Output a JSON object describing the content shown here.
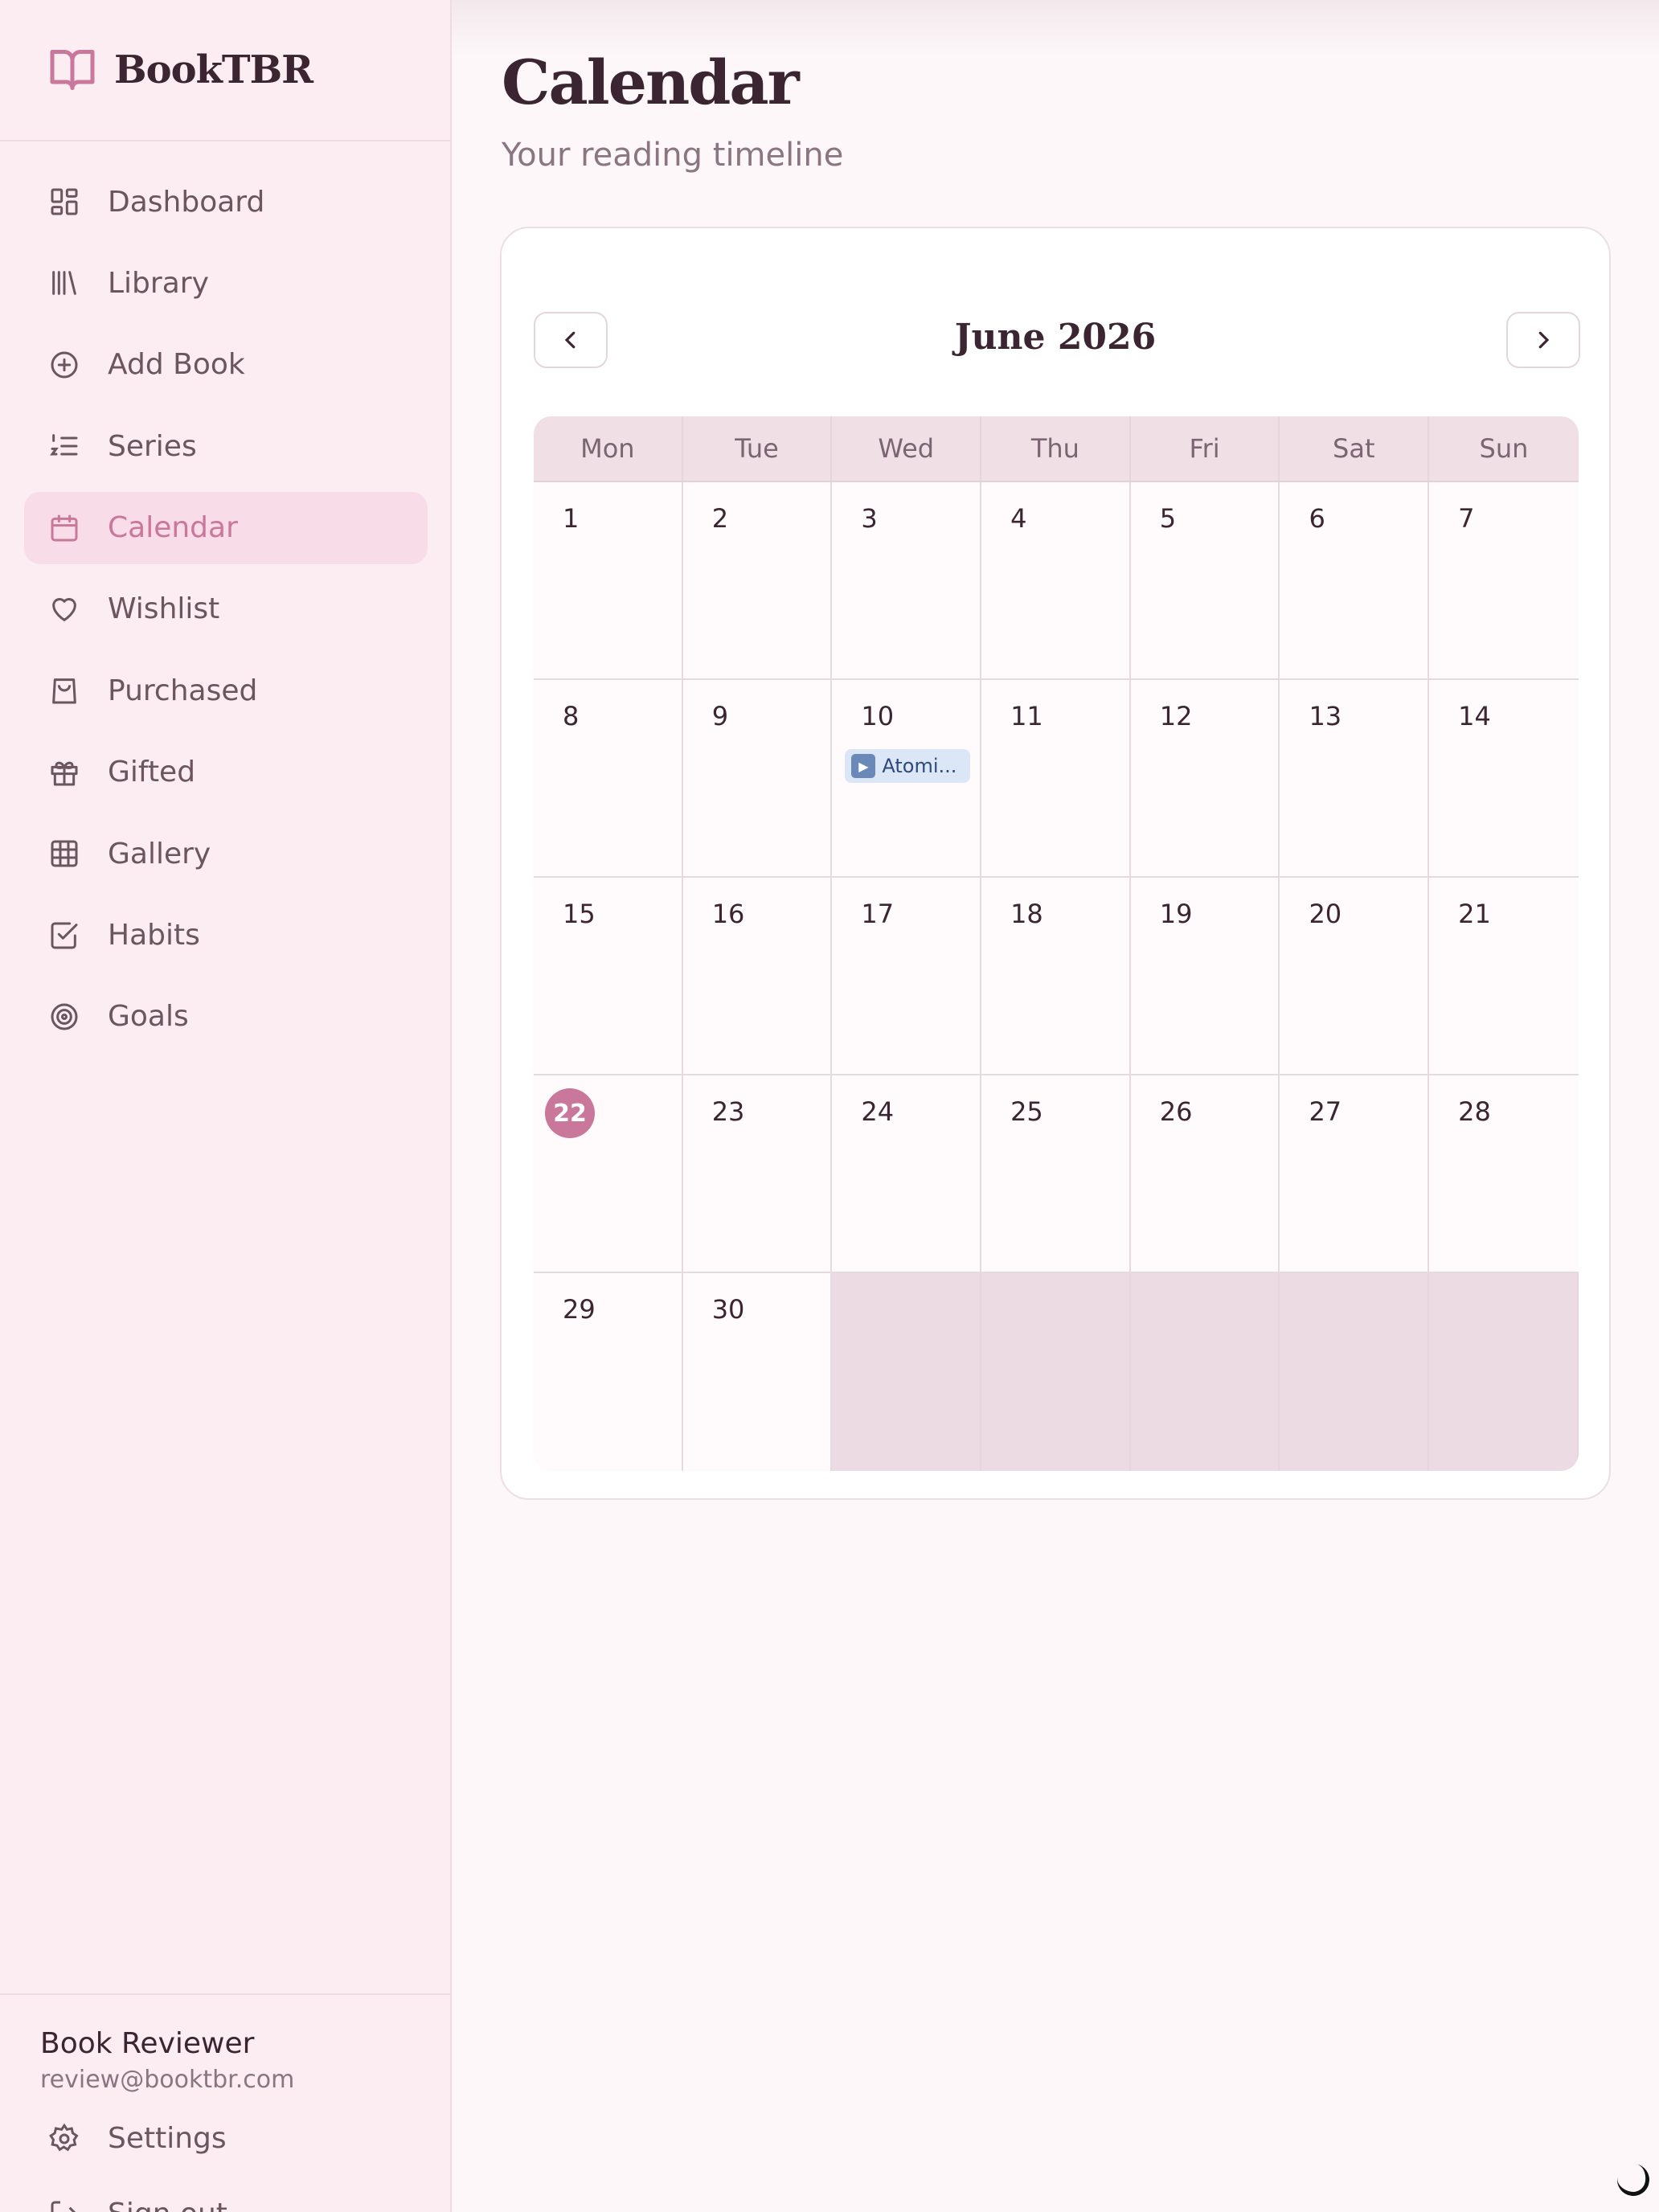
{
  "brand": {
    "name": "BookTBR"
  },
  "sidebar": {
    "items": [
      {
        "label": "Dashboard",
        "icon": "dashboard-icon"
      },
      {
        "label": "Library",
        "icon": "library-icon"
      },
      {
        "label": "Add Book",
        "icon": "add-circle-icon"
      },
      {
        "label": "Series",
        "icon": "list-ordered-icon"
      },
      {
        "label": "Calendar",
        "icon": "calendar-icon",
        "active": true
      },
      {
        "label": "Wishlist",
        "icon": "heart-icon"
      },
      {
        "label": "Purchased",
        "icon": "shopping-bag-icon"
      },
      {
        "label": "Gifted",
        "icon": "gift-icon"
      },
      {
        "label": "Gallery",
        "icon": "grid-icon"
      },
      {
        "label": "Habits",
        "icon": "check-square-icon"
      },
      {
        "label": "Goals",
        "icon": "target-icon"
      }
    ]
  },
  "user": {
    "name": "Book Reviewer",
    "email": "review@booktbr.com",
    "settings_label": "Settings",
    "signout_label": "Sign out"
  },
  "page": {
    "title": "Calendar",
    "subtitle": "Your reading timeline"
  },
  "calendar": {
    "month_label": "June 2026",
    "weekdays": [
      "Mon",
      "Tue",
      "Wed",
      "Thu",
      "Fri",
      "Sat",
      "Sun"
    ],
    "weeks": [
      [
        "1",
        "2",
        "3",
        "4",
        "5",
        "6",
        "7"
      ],
      [
        "8",
        "9",
        "10",
        "11",
        "12",
        "13",
        "14"
      ],
      [
        "15",
        "16",
        "17",
        "18",
        "19",
        "20",
        "21"
      ],
      [
        "22",
        "23",
        "24",
        "25",
        "26",
        "27",
        "28"
      ],
      [
        "29",
        "30",
        "",
        "",
        "",
        "",
        ""
      ]
    ],
    "today": "22",
    "events": [
      {
        "day": "10",
        "label": "Atomi...",
        "icon": "play-icon"
      }
    ]
  },
  "colors": {
    "accent": "#c9779a",
    "sidebar_bg": "#fcedf2",
    "active_bg": "#f8dce7",
    "event_bg": "#dbe7f7"
  }
}
